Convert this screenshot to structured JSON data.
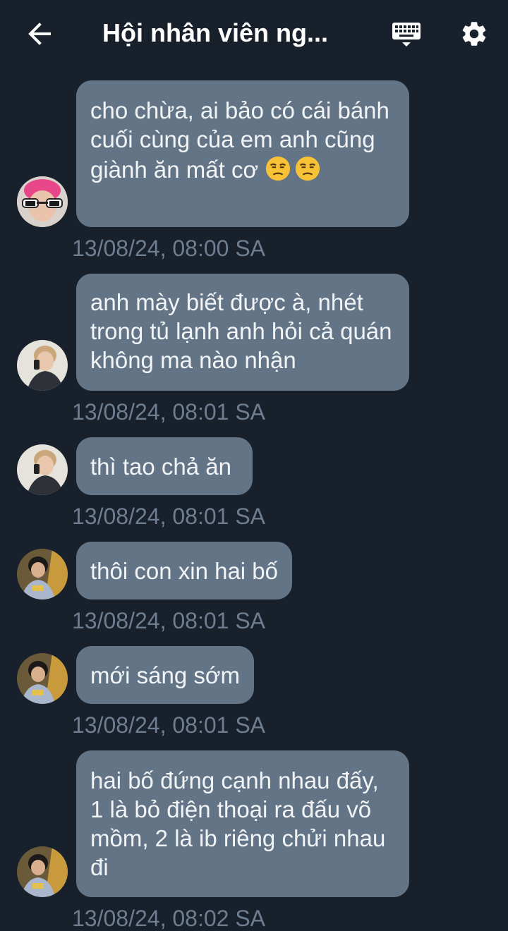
{
  "header": {
    "title": "Hội nhân viên ng...",
    "back_icon": "arrow-left-icon",
    "keyboard_icon": "keyboard-icon",
    "settings_icon": "gear-icon"
  },
  "messages": [
    {
      "text": "cho chừa, ai bảo có cái bánh cuối cùng của em anh cũng giành ăn mất cơ",
      "emoji": "😒😒",
      "time": "13/08/24, 08:00 SA"
    },
    {
      "text": "anh mày biết được à, nhét trong tủ lạnh anh hỏi cả quán không ma nào nhận",
      "time": "13/08/24, 08:01 SA"
    },
    {
      "text": "thì tao chả ăn",
      "time": "13/08/24, 08:01 SA"
    },
    {
      "text": "thôi con xin hai bố",
      "time": "13/08/24, 08:01 SA"
    },
    {
      "text": "mới sáng sớm",
      "time": "13/08/24, 08:01 SA"
    },
    {
      "text": "hai bố đứng cạnh nhau đấy, 1 là bỏ điện thoại ra đấu võ mồm, 2 là ib riêng chửi nhau đi",
      "time": "13/08/24, 08:02 SA"
    }
  ],
  "colors": {
    "background": "#18202b",
    "bubble": "#637486",
    "timestamp": "#6e7e90"
  }
}
